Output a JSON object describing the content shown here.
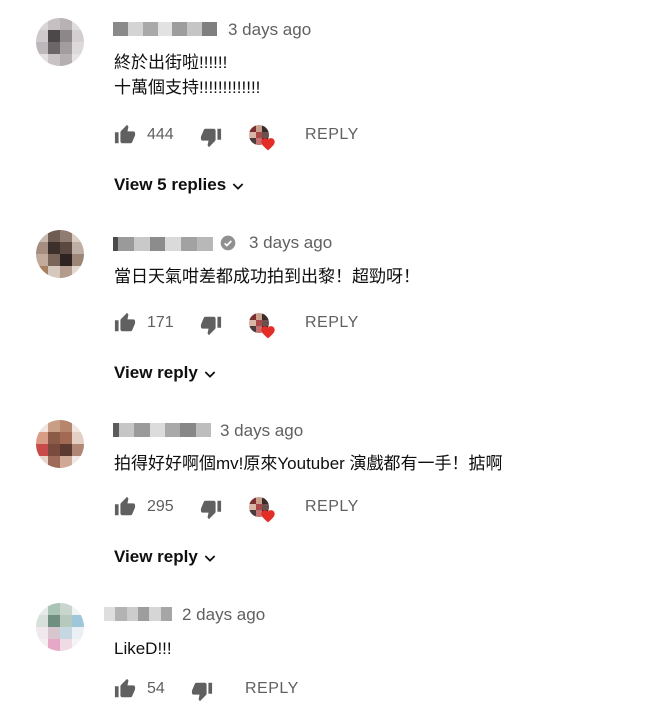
{
  "comments": [
    {
      "time": "3 days ago",
      "text_lines": [
        "終於出街啦!!!!!!",
        "十萬個支持!!!!!!!!!!!!!"
      ],
      "likes": "444",
      "reply_label": "REPLY",
      "view_replies": "View 5 replies",
      "verified": false
    },
    {
      "time": "3 days ago",
      "text_lines": [
        "當日天氣咁差都成功拍到出黎！超勁呀！"
      ],
      "likes": "171",
      "reply_label": "REPLY",
      "view_replies": "View reply",
      "verified": true
    },
    {
      "time": "3 days ago",
      "text_lines": [
        "拍得好好啊個mv!原來Youtuber 演戲都有一手！掂啊"
      ],
      "likes": "295",
      "reply_label": "REPLY",
      "view_replies": "View reply",
      "verified": false
    },
    {
      "time": "2 days ago",
      "text_lines": [
        "LikeD!!!"
      ],
      "likes": "54",
      "reply_label": "REPLY",
      "view_replies": "",
      "verified": false
    }
  ],
  "colors": {
    "heart": "#e52d27",
    "icon_gray": "#606060",
    "verified_gray": "#909090"
  },
  "icons": {
    "like": "thumb-up-icon",
    "dislike": "thumb-down-icon",
    "creator_heart": "creator-heart-icon",
    "chevron": "chevron-down-icon",
    "verified": "verified-check-icon"
  }
}
